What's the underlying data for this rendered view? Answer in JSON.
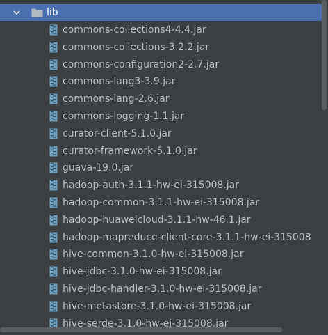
{
  "tree": {
    "folder": {
      "label": "lib",
      "expanded": true,
      "selected": true,
      "icon": "folder-icon",
      "chevron_icon": "chevron-down-icon"
    },
    "file_icon": "jar-archive-icon",
    "files": [
      {
        "label": "commons-collections4-4.4.jar"
      },
      {
        "label": "commons-collections-3.2.2.jar"
      },
      {
        "label": "commons-configuration2-2.7.jar"
      },
      {
        "label": "commons-lang3-3.9.jar"
      },
      {
        "label": "commons-lang-2.6.jar"
      },
      {
        "label": "commons-logging-1.1.jar"
      },
      {
        "label": "curator-client-5.1.0.jar"
      },
      {
        "label": "curator-framework-5.1.0.jar"
      },
      {
        "label": "guava-19.0.jar"
      },
      {
        "label": "hadoop-auth-3.1.1-hw-ei-315008.jar"
      },
      {
        "label": "hadoop-common-3.1.1-hw-ei-315008.jar"
      },
      {
        "label": "hadoop-huaweicloud-3.1.1-hw-46.1.jar"
      },
      {
        "label": "hadoop-mapreduce-client-core-3.1.1-hw-ei-315008"
      },
      {
        "label": "hive-common-3.1.0-hw-ei-315008.jar"
      },
      {
        "label": "hive-jdbc-3.1.0-hw-ei-315008.jar"
      },
      {
        "label": "hive-jdbc-handler-3.1.0-hw-ei-315008.jar"
      },
      {
        "label": "hive-metastore-3.1.0-hw-ei-315008.jar"
      },
      {
        "label": "hive-serde-3.1.0-hw-ei-315008.jar"
      }
    ]
  },
  "colors": {
    "background": "#3c3f41",
    "selection": "#4b6eaf",
    "text": "#bbbdbf",
    "jar_icon": "#6f9fbe",
    "folder_icon": "#aeb9c0",
    "scrollbar_thumb": "#5a5d5f"
  }
}
